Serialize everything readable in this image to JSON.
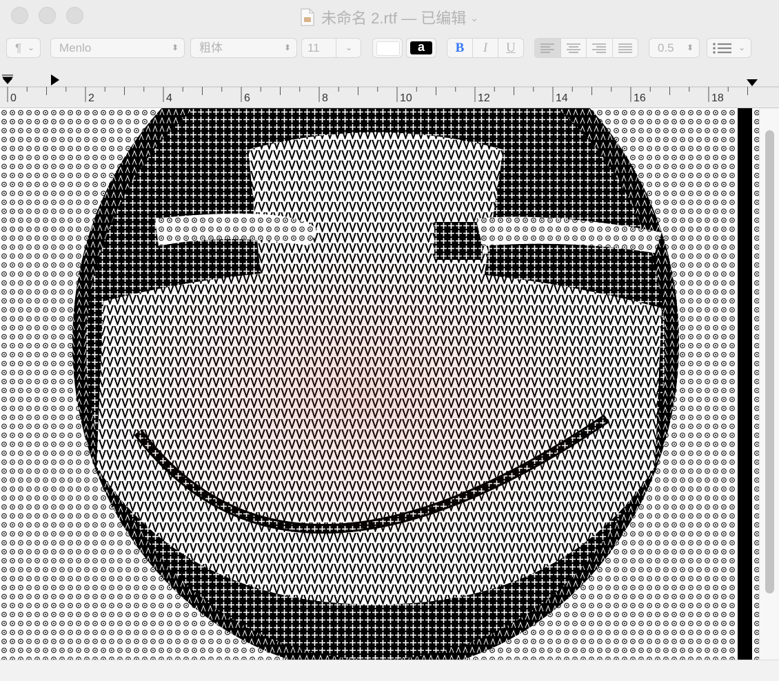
{
  "window": {
    "title": "未命名 2.rtf — 已编辑"
  },
  "toolbar": {
    "paragraph_style": "¶",
    "font_family": "Menlo",
    "typeface": "粗体",
    "font_size": "11",
    "text_color": "#ffffff",
    "background_color_label": "a",
    "bold": "B",
    "italic": "I",
    "underline": "U",
    "alignment": "left",
    "line_spacing": "0.5",
    "list_icon": "list-icon"
  },
  "ruler": {
    "labels": [
      "0",
      "2",
      "4",
      "6",
      "8",
      "10",
      "12",
      "14",
      "16",
      "18"
    ]
  },
  "document": {
    "content": "ascii-art-smiley-face"
  }
}
